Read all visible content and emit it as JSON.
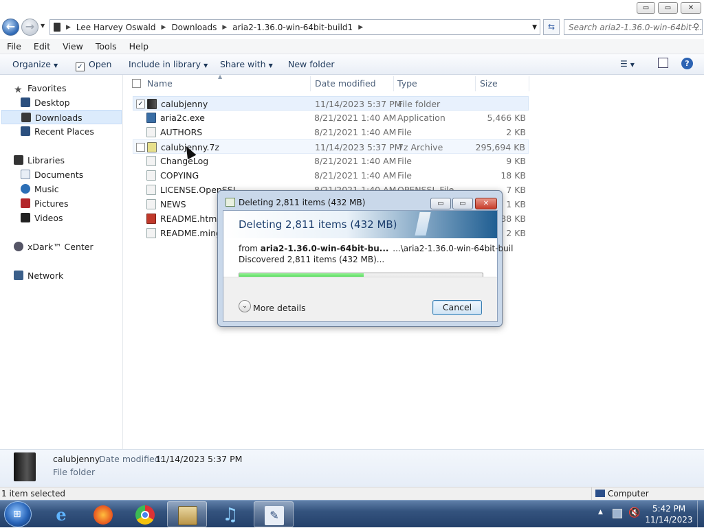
{
  "window": {
    "minimize": "▭",
    "restore": "▭",
    "close": "✕"
  },
  "address": {
    "back_icon": "back-arrow-icon",
    "segments": [
      "Lee Harvey Oswald",
      "Downloads",
      "aria2-1.36.0-win-64bit-build1"
    ],
    "search_placeholder": "Search aria2-1.36.0-win-64bit-..."
  },
  "menu": [
    "File",
    "Edit",
    "View",
    "Tools",
    "Help"
  ],
  "toolbar": {
    "organize": "Organize",
    "open": "Open",
    "include": "Include in library",
    "share": "Share with",
    "new_folder": "New folder"
  },
  "nav": {
    "favorites": "Favorites",
    "favorites_items": [
      "Desktop",
      "Downloads",
      "Recent Places"
    ],
    "libraries": "Libraries",
    "libraries_items": [
      "Documents",
      "Music",
      "Pictures",
      "Videos"
    ],
    "xdark": "xDark™ Center",
    "network": "Network"
  },
  "columns": {
    "name": "Name",
    "date": "Date modified",
    "type": "Type",
    "size": "Size"
  },
  "files": [
    {
      "name": "calubjenny",
      "date": "11/14/2023 5:37 PM",
      "type": "File folder",
      "size": ""
    },
    {
      "name": "aria2c.exe",
      "date": "8/21/2021 1:40 AM",
      "type": "Application",
      "size": "5,466 KB"
    },
    {
      "name": "AUTHORS",
      "date": "8/21/2021 1:40 AM",
      "type": "File",
      "size": "2 KB"
    },
    {
      "name": "calubjenny.7z",
      "date": "11/14/2023 5:37 PM",
      "type": "7z Archive",
      "size": "295,694 KB"
    },
    {
      "name": "ChangeLog",
      "date": "8/21/2021 1:40 AM",
      "type": "File",
      "size": "9 KB"
    },
    {
      "name": "COPYING",
      "date": "8/21/2021 1:40 AM",
      "type": "File",
      "size": "18 KB"
    },
    {
      "name": "LICENSE.OpenSSL",
      "date": "8/21/2021 1:40 AM",
      "type": "OPENSSL File",
      "size": "7 KB"
    },
    {
      "name": "NEWS",
      "date": "",
      "type": "",
      "size": "1 KB"
    },
    {
      "name": "README.html",
      "date": "",
      "type": "",
      "size": "38 KB"
    },
    {
      "name": "README.mingw",
      "date": "",
      "type": "",
      "size": "2 KB"
    }
  ],
  "details": {
    "name": "calubjenny",
    "date_label": "Date modified:",
    "date": "11/14/2023 5:37 PM",
    "kind": "File folder"
  },
  "status": {
    "selected": "1 item selected",
    "computer": "Computer"
  },
  "dialog": {
    "title": "Deleting 2,811 items (432 MB)",
    "heading": "Deleting 2,811 items (432 MB)",
    "from_label": "from",
    "from_name": "aria2-1.36.0-win-64bit-bu...",
    "to_path": "...\\aria2-1.36.0-win-64bit-buil",
    "discovered": "Discovered 2,811 items (432 MB)...",
    "progress": 0.51,
    "more_details": "More details",
    "cancel": "Cancel"
  },
  "taskbar": {
    "time": "5:42 PM",
    "date": "11/14/2023"
  }
}
